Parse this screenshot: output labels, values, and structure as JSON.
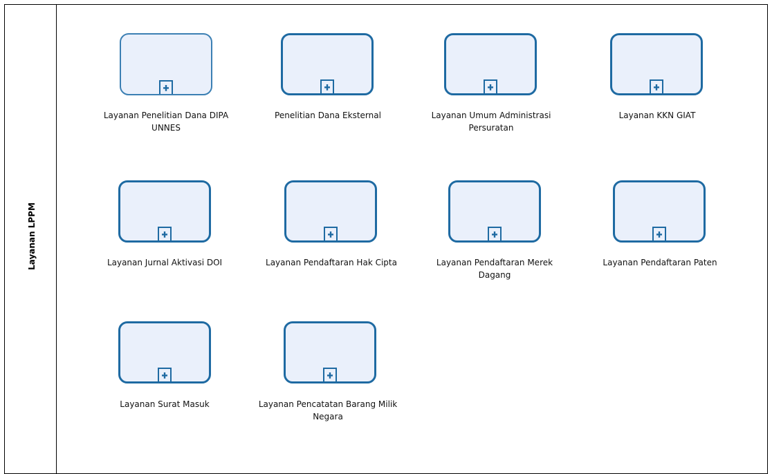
{
  "diagram": {
    "lane_title": "Layanan LPPM",
    "subprocesses": [
      {
        "label": "Layanan Penelitian Dana DIPA\nUNNES",
        "icon": "plus-icon",
        "selected": true
      },
      {
        "label": "Penelitian Dana Eksternal",
        "icon": "plus-icon"
      },
      {
        "label": "Layanan Umum Administrasi\nPersuratan",
        "icon": "plus-icon"
      },
      {
        "label": "Layanan KKN GIAT",
        "icon": "plus-icon"
      },
      {
        "label": "Layanan Jurnal Aktivasi DOI",
        "icon": "plus-icon"
      },
      {
        "label": "Layanan Pendaftaran Hak Cipta",
        "icon": "plus-icon"
      },
      {
        "label": "Layanan Pendaftaran Merek\nDagang",
        "icon": "plus-icon"
      },
      {
        "label": "Layanan Pendaftaran Paten",
        "icon": "plus-icon"
      },
      {
        "label": "Layanan Surat Masuk",
        "icon": "plus-icon"
      },
      {
        "label": "Layanan Pencatatan Barang Milik\nNegara",
        "icon": "plus-icon"
      }
    ],
    "colors": {
      "task_border": "#1e6aa2",
      "task_fill": "#eaf0fb",
      "line": "#000000"
    }
  }
}
